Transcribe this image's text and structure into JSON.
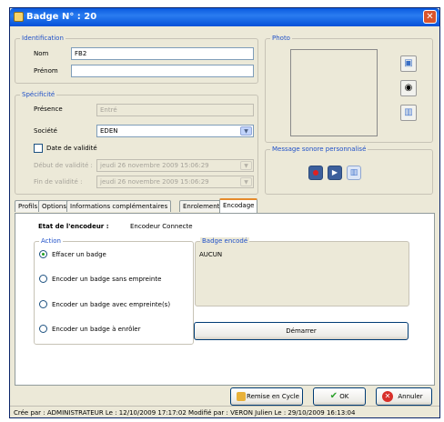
{
  "window": {
    "title": "Badge N° : 20",
    "close_glyph": "✕"
  },
  "identification": {
    "legend": "Identification",
    "nom_label": "Nom",
    "nom_value": "FB2",
    "prenom_label": "Prénom",
    "prenom_value": ""
  },
  "specificite": {
    "legend": "Spécificité",
    "presence_label": "Présence",
    "presence_value": "Entré",
    "societe_label": "Société",
    "societe_value": "EDEN",
    "date_validite_label": "Date de validité",
    "date_validite_checked": false,
    "debut_label": "Début de validité :",
    "debut_value": "jeudi   26 novembre 2009   15:06:29",
    "fin_label": "Fin de validité :",
    "fin_value": "jeudi   26 novembre 2009   15:06:29"
  },
  "photo": {
    "legend": "Photo"
  },
  "message": {
    "legend": "Message sonore personnalisé"
  },
  "tabs": [
    "Profils",
    "Options",
    "Informations complémentaires",
    "Enrolement",
    "Encodage"
  ],
  "active_tab": "Encodage",
  "encodage": {
    "etat_label": "Etat de l'encodeur :",
    "etat_value": "Encodeur Connecte",
    "action_legend": "Action",
    "actions": [
      {
        "label": "Effacer un badge",
        "selected": true
      },
      {
        "label": "Encoder un badge sans empreinte",
        "selected": false
      },
      {
        "label": "Encoder un badge avec empreinte(s)",
        "selected": false
      },
      {
        "label": "Encoder un badge à enrôler",
        "selected": false
      }
    ],
    "badge_legend": "Badge encodé",
    "badge_value": "AUCUN",
    "demarrer_label": "Démarrer"
  },
  "footer": {
    "remise_label": "Remise en Cycle",
    "ok_label": "OK",
    "annuler_label": "Annuler"
  },
  "status": "Crée par : ADMINISTRATEUR  Le : 12/10/2009 17:17:02  Modifié par : VERON Julien Le : 29/10/2009 16:13:04",
  "colors": {
    "accent": "#1f50c8",
    "title_bar": "#0a5ae0",
    "tab_active": "#e68b2c"
  }
}
